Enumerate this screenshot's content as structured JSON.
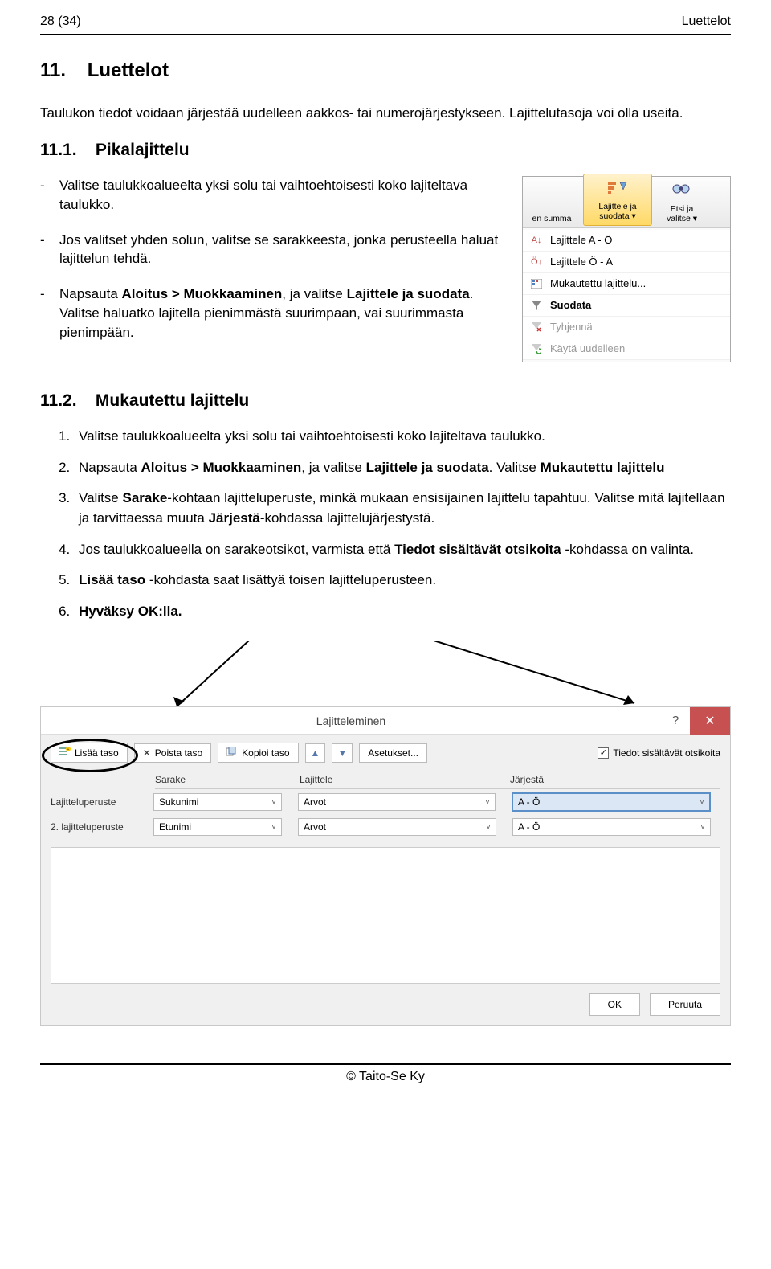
{
  "header": {
    "left": "28 (34)",
    "right": "Luettelot"
  },
  "h1": {
    "num": "11.",
    "text": "Luettelot"
  },
  "intro": "Taulukon tiedot voidaan järjestää uudelleen aakkos- tai numerojärjestykseen. Lajittelutasoja voi olla useita.",
  "h2a": {
    "num": "11.1.",
    "text": "Pikalajittelu"
  },
  "dash": [
    "Valitse taulukkoalueelta yksi solu tai vaihtoehtoisesti koko lajiteltava taulukko.",
    "Jos valitset yhden solun, valitse se sarakkeesta, jonka perusteella haluat lajittelun tehdä.",
    "Napsauta Aloitus > Muokkaaminen, ja valitse Lajittele ja suodata. Valitse haluatko lajitella pienimmästä suurimpaan, vai suurimmasta pienimpään."
  ],
  "dash3_bold1": "Aloitus > Muokkaaminen",
  "dash3_bold2": "Lajittele ja suodata",
  "dash3_pre": "Napsauta ",
  "dash3_mid": ", ja valitse ",
  "dash3_post": ". Valitse haluatko lajitella pienimmästä suurimpaan, vai suurimmasta pienimpään.",
  "ribbon": {
    "col1": "en summa",
    "col2": [
      "Lajittele ja",
      "suodata"
    ],
    "col3": [
      "Etsi ja",
      "valitse"
    ],
    "menu": [
      "Lajittele A - Ö",
      "Lajittele Ö - A",
      "Mukautettu lajittelu...",
      "Suodata",
      "Tyhjennä",
      "Käytä uudelleen"
    ]
  },
  "h2b": {
    "num": "11.2.",
    "text": "Mukautettu lajittelu"
  },
  "ol": {
    "i1": "Valitse taulukkoalueelta yksi solu tai vaihtoehtoisesti koko lajiteltava taulukko.",
    "i2_pre": "Napsauta ",
    "i2_b1": "Aloitus > Muokkaaminen",
    "i2_mid": ", ja valitse ",
    "i2_b2": "Lajittele ja suodata",
    "i2_mid2": ". Valitse ",
    "i2_b3": "Mukautettu lajittelu",
    "i3_pre": "Valitse ",
    "i3_b1": "Sarake",
    "i3_mid1": "-kohtaan lajitteluperuste, minkä mukaan ensisijainen lajittelu tapahtuu. Valitse mitä lajitellaan ja tarvittaessa muuta ",
    "i3_b2": "Järjestä",
    "i3_post": "-kohdassa lajittelujärjestystä.",
    "i4_pre": "Jos taulukkoalueella on sarakeotsikot, varmista että ",
    "i4_b": "Tiedot sisältävät otsikoita",
    "i4_post": " -kohdassa on valinta.",
    "i5_b": "Lisää taso",
    "i5_post": " -kohdasta saat lisättyä toisen lajitteluperusteen.",
    "i6_b": "Hyväksy OK:lla."
  },
  "dialog": {
    "title": "Lajitteleminen",
    "btn_add": "Lisää taso",
    "btn_del": "Poista taso",
    "btn_copy": "Kopioi taso",
    "btn_opts": "Asetukset...",
    "chk": "Tiedot sisältävät otsikoita",
    "colnames": [
      "Sarake",
      "Lajittele",
      "Järjestä"
    ],
    "rows": [
      {
        "label": "Lajitteluperuste",
        "c1": "Sukunimi",
        "c2": "Arvot",
        "c3": "A - Ö",
        "hl": true
      },
      {
        "label": "2. lajitteluperuste",
        "c1": "Etunimi",
        "c2": "Arvot",
        "c3": "A - Ö",
        "hl": false
      }
    ],
    "ok": "OK",
    "cancel": "Peruuta"
  },
  "footer": "© Taito-Se Ky"
}
